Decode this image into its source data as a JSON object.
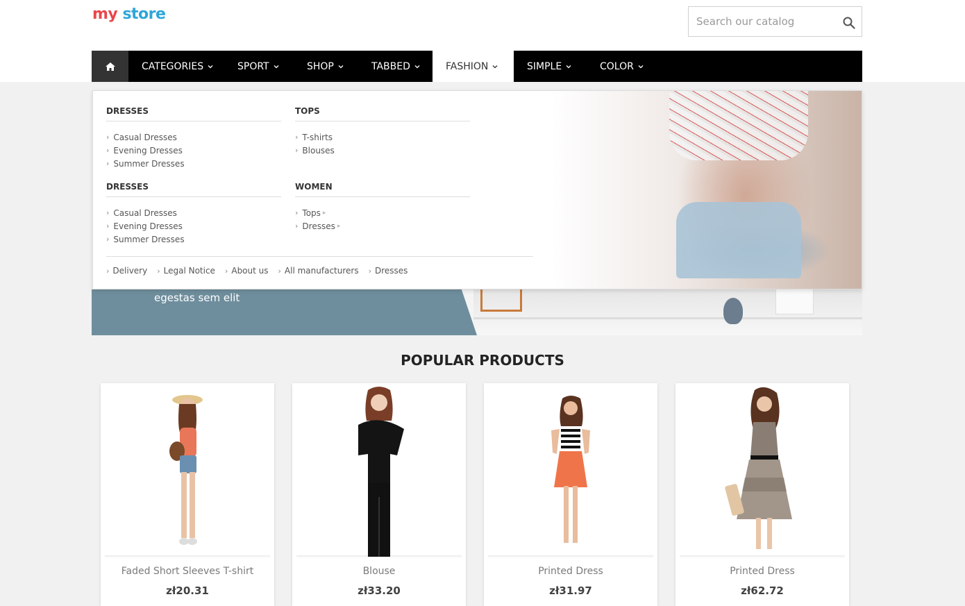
{
  "logo": {
    "part1": "my",
    "part2": "store"
  },
  "search": {
    "placeholder": "Search our catalog"
  },
  "nav": {
    "items": [
      {
        "label": "CATEGORIES"
      },
      {
        "label": "SPORT"
      },
      {
        "label": "SHOP"
      },
      {
        "label": "TABBED"
      },
      {
        "label": "FASHION"
      },
      {
        "label": "SIMPLE"
      },
      {
        "label": "COLOR"
      }
    ],
    "active": "FASHION"
  },
  "dropdown": {
    "columns": [
      {
        "title": "DRESSES",
        "links": [
          "Casual Dresses",
          "Evening Dresses",
          "Summer Dresses"
        ]
      },
      {
        "title": "TOPS",
        "links": [
          "T-shirts",
          "Blouses"
        ]
      },
      {
        "title": "DRESSES",
        "links": [
          "Casual Dresses",
          "Evening Dresses",
          "Summer Dresses"
        ]
      },
      {
        "title": "WOMEN",
        "links": [
          "Tops",
          "Dresses"
        ]
      }
    ],
    "footer_links": [
      "Delivery",
      "Legal Notice",
      "About us",
      "All manufacturers",
      "Dresses"
    ]
  },
  "slider": {
    "caption": "egestas sem elit"
  },
  "section": {
    "title": "POPULAR PRODUCTS"
  },
  "products": [
    {
      "name": "Faded Short Sleeves T-shirt",
      "price": "zł20.31"
    },
    {
      "name": "Blouse",
      "price": "zł33.20"
    },
    {
      "name": "Printed Dress",
      "price": "zł31.97"
    },
    {
      "name": "Printed Dress",
      "price": "zł62.72"
    }
  ],
  "colors": {
    "nav_bg": "#000000",
    "home_bg": "#333333",
    "slider_bg": "#6f8e9d"
  }
}
